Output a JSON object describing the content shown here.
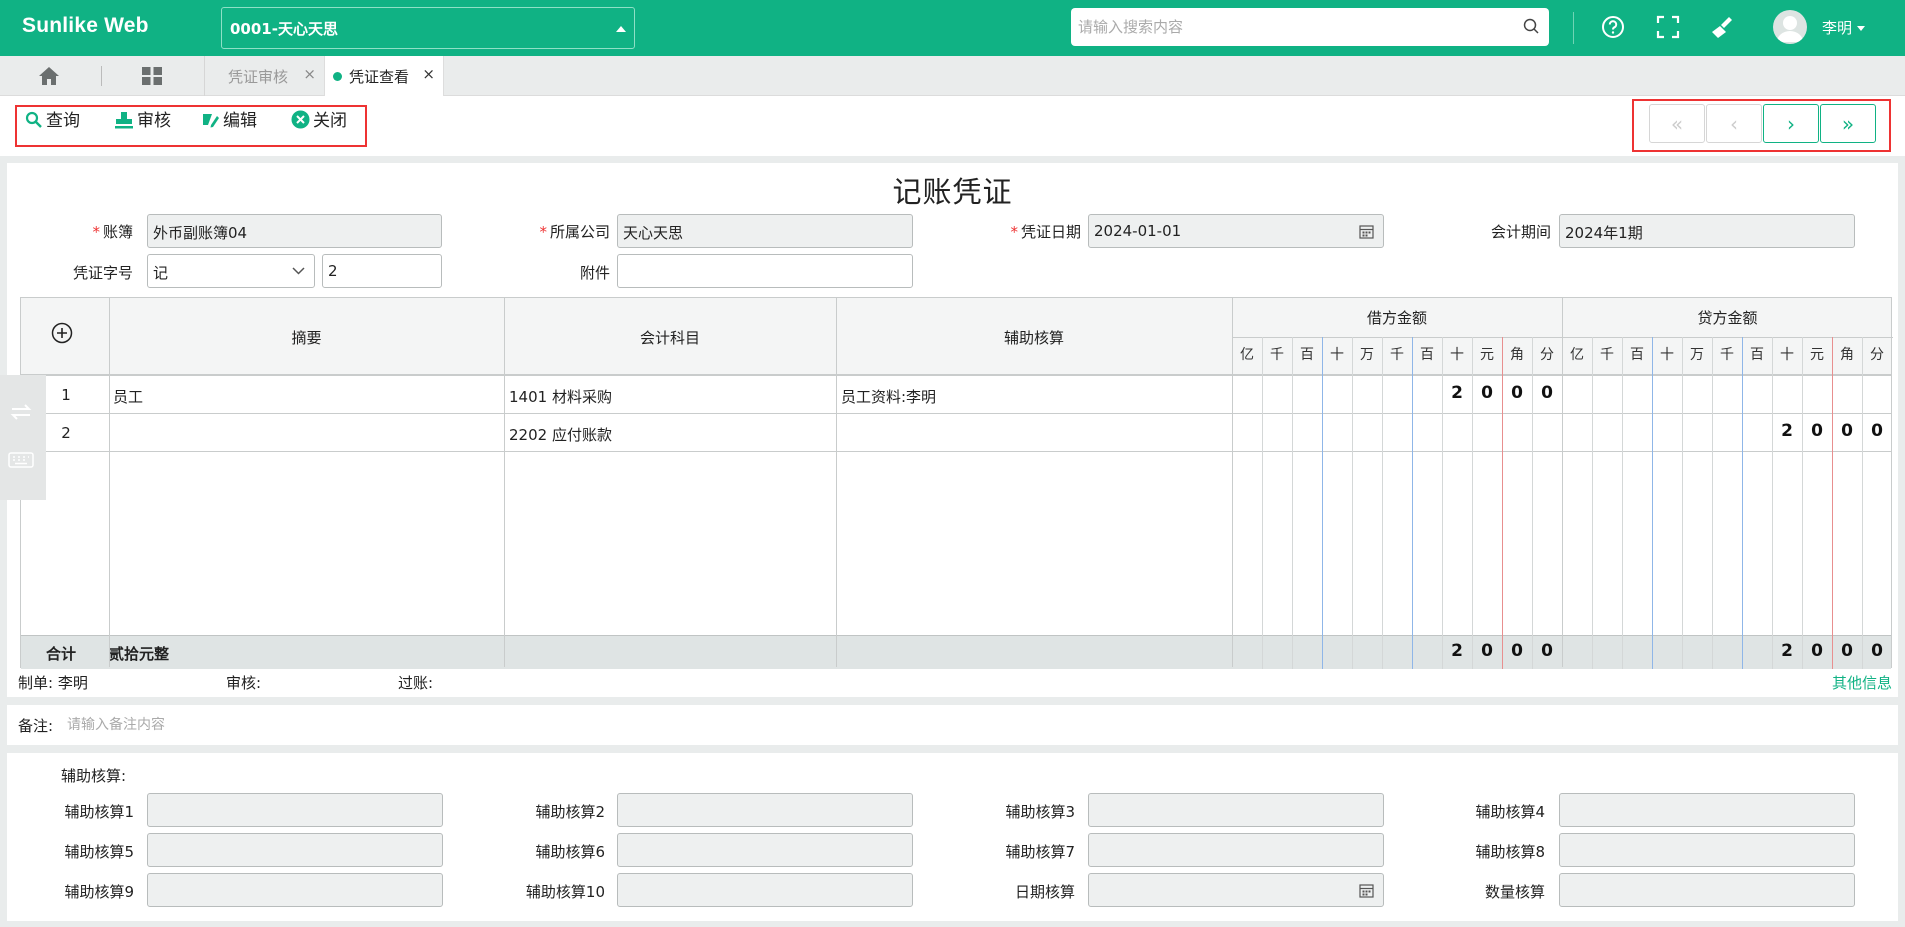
{
  "header": {
    "brand": "Sunlike Web",
    "account_select": "0001-天心天思",
    "search_placeholder": "请输入搜索内容",
    "user_name": "李明"
  },
  "tabs": [
    {
      "label": "凭证审核",
      "active": false
    },
    {
      "label": "凭证查看",
      "active": true
    }
  ],
  "toolbar": {
    "query": "查询",
    "audit": "审核",
    "edit": "编辑",
    "close": "关闭"
  },
  "navigator": {
    "first": "«",
    "prev": "‹",
    "next": "›",
    "last": "»"
  },
  "voucher": {
    "title": "记账凭证",
    "fields": {
      "ledger_label": "账簿",
      "ledger_value": "外币副账簿04",
      "company_label": "所属公司",
      "company_value": "天心天思",
      "date_label": "凭证日期",
      "date_value": "2024-01-01",
      "period_label": "会计期间",
      "period_value": "2024年1期",
      "word_label": "凭证字号",
      "word_value": "记",
      "number_value": "2",
      "attach_label": "附件",
      "attach_value": ""
    },
    "table": {
      "col_summary": "摘要",
      "col_account": "会计科目",
      "col_aux": "辅助核算",
      "col_debit": "借方金额",
      "col_credit": "贷方金额",
      "digit_units": [
        "亿",
        "千",
        "百",
        "十",
        "万",
        "千",
        "百",
        "十",
        "元",
        "角",
        "分"
      ],
      "rows": [
        {
          "no": "1",
          "summary": "员工",
          "account": "1401 材料采购",
          "aux": "员工资料:李明",
          "debit": [
            "",
            "",
            "",
            "",
            "",
            "",
            "",
            "2",
            "0",
            "0",
            "0"
          ],
          "credit": [
            "",
            "",
            "",
            "",
            "",
            "",
            "",
            "",
            "",
            "",
            ""
          ]
        },
        {
          "no": "2",
          "summary": "",
          "account": "2202 应付账款",
          "aux": "",
          "debit": [
            "",
            "",
            "",
            "",
            "",
            "",
            "",
            "",
            "",
            "",
            ""
          ],
          "credit": [
            "",
            "",
            "",
            "",
            "",
            "",
            "",
            "2",
            "0",
            "0",
            "0"
          ]
        }
      ],
      "total_label": "合计",
      "total_words": "贰拾元整",
      "total_debit": [
        "",
        "",
        "",
        "",
        "",
        "",
        "",
        "2",
        "0",
        "0",
        "0"
      ],
      "total_credit": [
        "",
        "",
        "",
        "",
        "",
        "",
        "",
        "2",
        "0",
        "0",
        "0"
      ]
    },
    "footer": {
      "maker": "制单: 李明",
      "auditor": "审核:",
      "poster": "过账:",
      "other_info": "其他信息"
    }
  },
  "notes": {
    "label": "备注:",
    "placeholder": "请输入备注内容"
  },
  "aux_panel": {
    "title": "辅助核算:",
    "fields": [
      "辅助核算1",
      "辅助核算2",
      "辅助核算3",
      "辅助核算4",
      "辅助核算5",
      "辅助核算6",
      "辅助核算7",
      "辅助核算8",
      "辅助核算9",
      "辅助核算10",
      "日期核算",
      "数量核算"
    ]
  },
  "colors": {
    "primary": "#10b284",
    "highlight_border": "#ee3333"
  }
}
